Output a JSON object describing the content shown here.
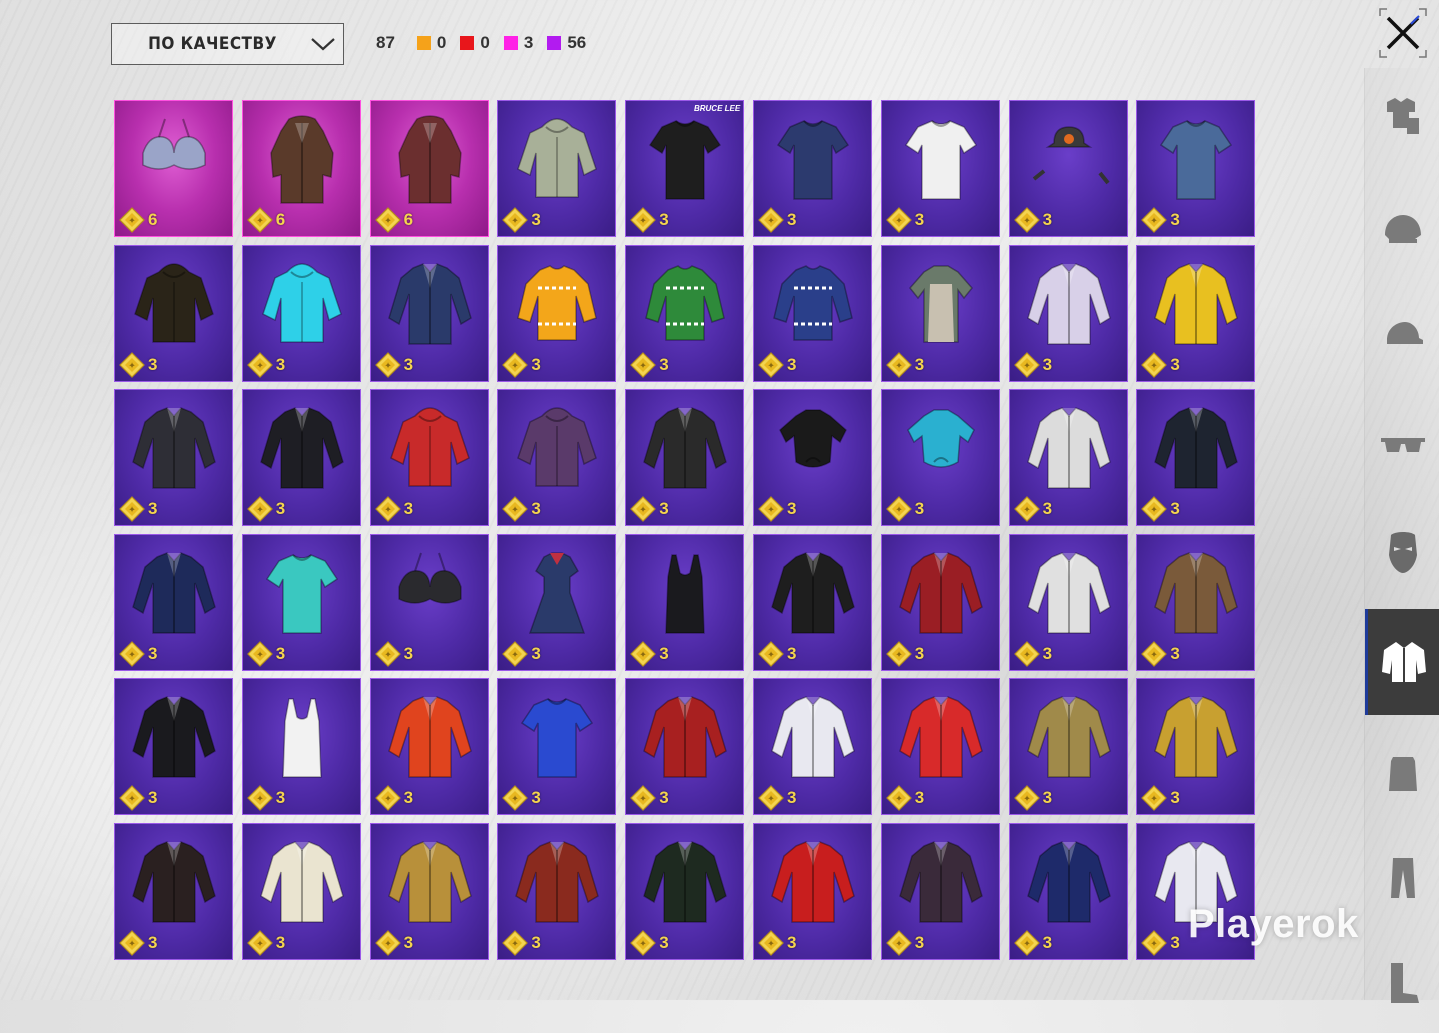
{
  "sort": {
    "label": "ПО КАЧЕСТВУ",
    "icon": "chevron-down-icon"
  },
  "stats": {
    "total": "87",
    "rarities": [
      {
        "color": "#f5a21a",
        "count": "0"
      },
      {
        "color": "#e8161b",
        "count": "0"
      },
      {
        "color": "#ff22e6",
        "count": "3"
      },
      {
        "color": "#b21bf0",
        "count": "56"
      }
    ]
  },
  "close_icon": "close-icon",
  "sidebar": {
    "tabs": [
      {
        "name": "outfit-set-icon",
        "active": false
      },
      {
        "name": "helmet-icon",
        "active": false
      },
      {
        "name": "cap-icon",
        "active": false
      },
      {
        "name": "glasses-icon",
        "active": false
      },
      {
        "name": "mask-icon",
        "active": false
      },
      {
        "name": "jacket-icon",
        "active": true
      },
      {
        "name": "backpack-icon",
        "active": false
      },
      {
        "name": "pants-icon",
        "active": false
      },
      {
        "name": "boots-icon",
        "active": false
      }
    ]
  },
  "items": [
    {
      "count": "6",
      "rarity": "pink",
      "color": "#9aa4c8",
      "kind": "bra"
    },
    {
      "count": "6",
      "rarity": "pink",
      "color": "#5a3a2a",
      "kind": "coat"
    },
    {
      "count": "6",
      "rarity": "pink",
      "color": "#6b2f2f",
      "kind": "coat"
    },
    {
      "count": "3",
      "rarity": "purple",
      "color": "#a8b098",
      "kind": "hoodie"
    },
    {
      "count": "3",
      "rarity": "purple",
      "color": "#1e1e1e",
      "kind": "tshirt",
      "brand": "BRUCE LEE"
    },
    {
      "count": "3",
      "rarity": "purple",
      "color": "#2c3a6e",
      "kind": "tshirt"
    },
    {
      "count": "3",
      "rarity": "purple",
      "color": "#f0f0f0",
      "kind": "tshirt"
    },
    {
      "count": "3",
      "rarity": "purple",
      "color": "#3a3a3a",
      "kind": "cap"
    },
    {
      "count": "3",
      "rarity": "purple",
      "color": "#4a6a9a",
      "kind": "tshirt"
    },
    {
      "count": "3",
      "rarity": "purple",
      "color": "#2a2418",
      "kind": "hoodie"
    },
    {
      "count": "3",
      "rarity": "purple",
      "color": "#2ed0e8",
      "kind": "hoodie"
    },
    {
      "count": "3",
      "rarity": "purple",
      "color": "#2a3a6a",
      "kind": "jacket"
    },
    {
      "count": "3",
      "rarity": "purple",
      "color": "#f3a61a",
      "kind": "sweater"
    },
    {
      "count": "3",
      "rarity": "purple",
      "color": "#2e8a3a",
      "kind": "sweater"
    },
    {
      "count": "3",
      "rarity": "purple",
      "color": "#2a3f8a",
      "kind": "sweater"
    },
    {
      "count": "3",
      "rarity": "purple",
      "color": "#c8c0b0",
      "kind": "apron"
    },
    {
      "count": "3",
      "rarity": "purple",
      "color": "#d8d0e8",
      "kind": "jacket"
    },
    {
      "count": "3",
      "rarity": "purple",
      "color": "#e8c020",
      "kind": "jacket"
    },
    {
      "count": "3",
      "rarity": "purple",
      "color": "#2e2e36",
      "kind": "jacket"
    },
    {
      "count": "3",
      "rarity": "purple",
      "color": "#1e1e24",
      "kind": "jacket"
    },
    {
      "count": "3",
      "rarity": "purple",
      "color": "#c82a2a",
      "kind": "hoodie"
    },
    {
      "count": "3",
      "rarity": "purple",
      "color": "#5a3a6a",
      "kind": "hoodie"
    },
    {
      "count": "3",
      "rarity": "purple",
      "color": "#2a2a2a",
      "kind": "jacket"
    },
    {
      "count": "3",
      "rarity": "purple",
      "color": "#1a1a1a",
      "kind": "crop"
    },
    {
      "count": "3",
      "rarity": "purple",
      "color": "#2ab0d0",
      "kind": "crop"
    },
    {
      "count": "3",
      "rarity": "purple",
      "color": "#dcdcdc",
      "kind": "jacket"
    },
    {
      "count": "3",
      "rarity": "purple",
      "color": "#1e2430",
      "kind": "jacket"
    },
    {
      "count": "3",
      "rarity": "purple",
      "color": "#1e2a5a",
      "kind": "jacket"
    },
    {
      "count": "3",
      "rarity": "purple",
      "color": "#3ac8c0",
      "kind": "tshirt"
    },
    {
      "count": "3",
      "rarity": "purple",
      "color": "#2a2a2e",
      "kind": "bra"
    },
    {
      "count": "3",
      "rarity": "purple",
      "color": "#2a3a6a",
      "kind": "dress"
    },
    {
      "count": "3",
      "rarity": "purple",
      "color": "#1a1a1e",
      "kind": "tank"
    },
    {
      "count": "3",
      "rarity": "purple",
      "color": "#1e1e1e",
      "kind": "jacket"
    },
    {
      "count": "3",
      "rarity": "purple",
      "color": "#9a1e24",
      "kind": "jacket"
    },
    {
      "count": "3",
      "rarity": "purple",
      "color": "#e0e0e0",
      "kind": "jacket"
    },
    {
      "count": "3",
      "rarity": "purple",
      "color": "#7a5a3a",
      "kind": "jacket"
    },
    {
      "count": "3",
      "rarity": "purple",
      "color": "#1a1a1e",
      "kind": "jacket"
    },
    {
      "count": "3",
      "rarity": "purple",
      "color": "#f2f2f2",
      "kind": "tank"
    },
    {
      "count": "3",
      "rarity": "purple",
      "color": "#e0441e",
      "kind": "jacket"
    },
    {
      "count": "3",
      "rarity": "purple",
      "color": "#2a4ad0",
      "kind": "tshirt"
    },
    {
      "count": "3",
      "rarity": "purple",
      "color": "#a82020",
      "kind": "jacket"
    },
    {
      "count": "3",
      "rarity": "purple",
      "color": "#e8e8f0",
      "kind": "jacket"
    },
    {
      "count": "3",
      "rarity": "purple",
      "color": "#d82a2a",
      "kind": "jacket"
    },
    {
      "count": "3",
      "rarity": "purple",
      "color": "#a08a4a",
      "kind": "jacket"
    },
    {
      "count": "3",
      "rarity": "purple",
      "color": "#c8a030",
      "kind": "jacket"
    },
    {
      "count": "3",
      "rarity": "purple",
      "color": "#2a2020",
      "kind": "jacket"
    },
    {
      "count": "3",
      "rarity": "purple",
      "color": "#eae4d0",
      "kind": "jacket"
    },
    {
      "count": "3",
      "rarity": "purple",
      "color": "#b8903a",
      "kind": "jacket"
    },
    {
      "count": "3",
      "rarity": "purple",
      "color": "#8a2a1e",
      "kind": "jacket"
    },
    {
      "count": "3",
      "rarity": "purple",
      "color": "#1e2a20",
      "kind": "jacket"
    },
    {
      "count": "3",
      "rarity": "purple",
      "color": "#c81e1e",
      "kind": "jacket"
    },
    {
      "count": "3",
      "rarity": "purple",
      "color": "#3a2a3a",
      "kind": "jacket"
    },
    {
      "count": "3",
      "rarity": "purple",
      "color": "#1e2a6a",
      "kind": "jacket"
    },
    {
      "count": "3",
      "rarity": "purple",
      "color": "#e8e8f0",
      "kind": "jacket"
    }
  ],
  "watermark": "Playerok"
}
